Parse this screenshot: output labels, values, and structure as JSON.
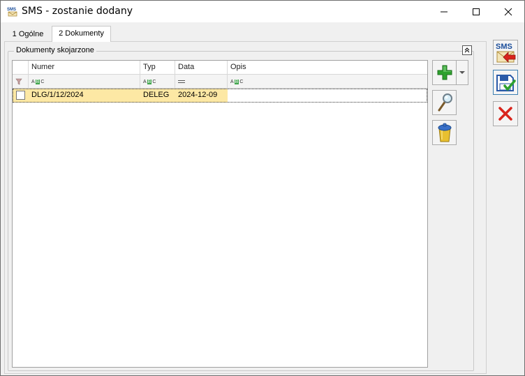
{
  "window": {
    "title": "SMS - zostanie dodany",
    "icon_label": "SMS"
  },
  "tabs": [
    {
      "label": "1 Ogólne",
      "active": false
    },
    {
      "label": "2 Dokumenty",
      "active": true
    }
  ],
  "group": {
    "title": "Dokumenty skojarzone"
  },
  "grid": {
    "columns": [
      "",
      "Numer",
      "Typ",
      "Data",
      "Opis"
    ],
    "rows": [
      {
        "checked": false,
        "numer": "DLG/1/12/2024",
        "typ": "DELEG",
        "data": "2024-12-09",
        "opis": ""
      }
    ]
  },
  "buttons": {
    "sms_label": "SMS"
  },
  "colors": {
    "row_highlight": "#fde8a4",
    "add_green": "#2ea12e",
    "cancel_red": "#d9241c"
  }
}
